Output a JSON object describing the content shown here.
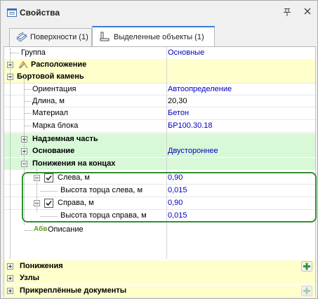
{
  "window": {
    "title": "Свойства"
  },
  "tabs": [
    {
      "label": "Поверхности (1)",
      "active": false,
      "icon": "surfaces-icon"
    },
    {
      "label": "Выделенные объекты (1)",
      "active": true,
      "icon": "selected-objects-icon"
    }
  ],
  "rows": {
    "group": {
      "label": "Группа",
      "value": "Основные"
    },
    "location": {
      "label": "Расположение"
    },
    "curb": {
      "label": "Бортовой камень"
    },
    "orientation": {
      "label": "Ориентация",
      "value": "Автоопределение"
    },
    "length": {
      "label": "Длина, м",
      "value": "20,30"
    },
    "material": {
      "label": "Материал",
      "value": "Бетон"
    },
    "block": {
      "label": "Марка блока",
      "value": "БР100.30.18"
    },
    "above": {
      "label": "Надземная часть"
    },
    "base": {
      "label": "Основание",
      "value": "Двустороннее"
    },
    "lowerings": {
      "label": "Понижения на концах"
    },
    "left": {
      "label": "Слева, м",
      "value": "0,90",
      "checked": true
    },
    "left_height": {
      "label": "Высота торца слева, м",
      "value": "0,015"
    },
    "right": {
      "label": "Справа, м",
      "value": "0,90",
      "checked": true
    },
    "right_height": {
      "label": "Высота торца справа, м",
      "value": "0,015"
    },
    "description": {
      "prefix": "Абв",
      "label": "Описание"
    }
  },
  "bottom": {
    "lowerings": {
      "label": "Понижения"
    },
    "nodes": {
      "label": "Узлы"
    },
    "attached": {
      "label": "Прикреплённые документы"
    }
  },
  "colors": {
    "category_bg": "#ffffcc",
    "subcategory_bg": "#d8f8d8",
    "value_text": "#0000c0",
    "highlight_border": "#2f8f2f",
    "add_button": "#2e9a2e"
  }
}
